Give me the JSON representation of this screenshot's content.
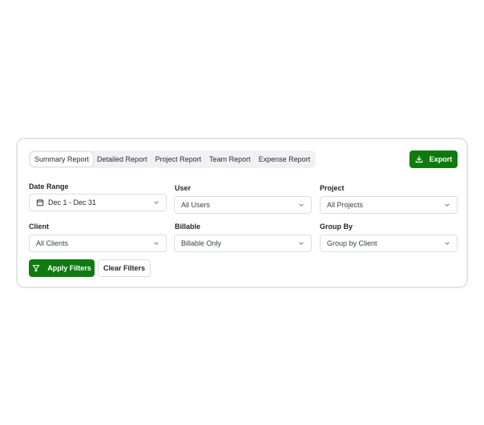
{
  "tabs": [
    {
      "label": "Summary Report",
      "active": true
    },
    {
      "label": "Detailed Report",
      "active": false
    },
    {
      "label": "Project Report",
      "active": false
    },
    {
      "label": "Team Report",
      "active": false
    },
    {
      "label": "Expense Report",
      "active": false
    }
  ],
  "export_label": "Export",
  "filters": {
    "date_range": {
      "label": "Date Range",
      "value": "Dec 1 - Dec 31"
    },
    "user": {
      "label": "User",
      "value": "All Users"
    },
    "project": {
      "label": "Project",
      "value": "All Projects"
    },
    "client": {
      "label": "Client",
      "value": "All Clients"
    },
    "billable": {
      "label": "Billable",
      "value": "Billable Only"
    },
    "group_by": {
      "label": "Group By",
      "value": "Group by Client"
    }
  },
  "actions": {
    "apply_label": "Apply Filters",
    "clear_label": "Clear Filters"
  },
  "colors": {
    "accent": "#0f7b0f",
    "border": "#e3e5e8"
  }
}
